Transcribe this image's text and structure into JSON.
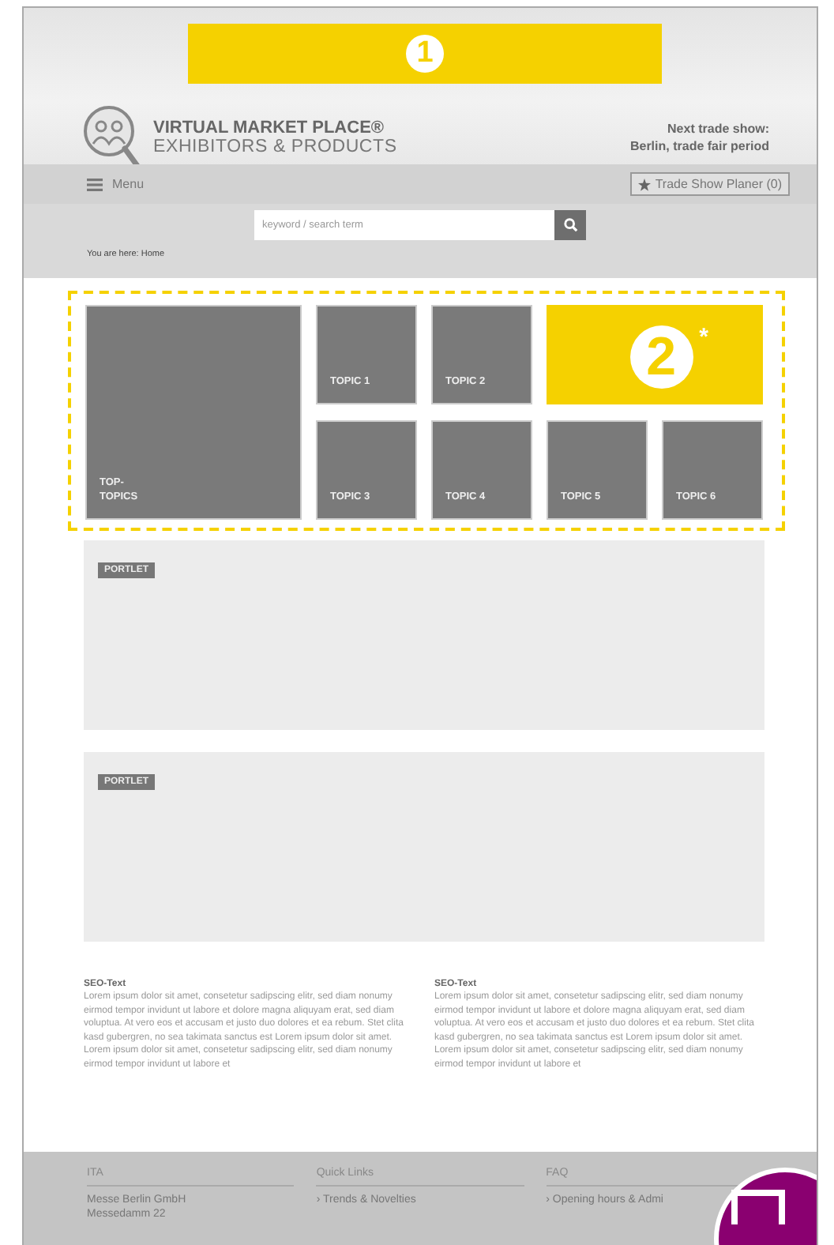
{
  "header_marker": "1",
  "logo": {
    "title": "VIRTUAL MARKET PLACE®",
    "subtitle": "EXHIBITORS & PRODUCTS"
  },
  "next_show": {
    "label": "Next trade show:",
    "value": "Berlin, trade fair period"
  },
  "nav": {
    "menu": "Menu",
    "planner": "Trade Show Planer (0)"
  },
  "search": {
    "placeholder": "keyword / search term"
  },
  "breadcrumb": "You are here: Home",
  "tiles": [
    {
      "kind": "top",
      "lines": [
        "TOP-",
        "TOPICS"
      ]
    },
    {
      "kind": "topic",
      "lines": [
        "TOPIC 1"
      ]
    },
    {
      "kind": "topic",
      "lines": [
        "TOPIC 2"
      ]
    },
    {
      "kind": "marker",
      "lines": [
        "2"
      ],
      "note": "*"
    },
    {
      "kind": "topic",
      "lines": [
        "TOPIC 3"
      ]
    },
    {
      "kind": "topic",
      "lines": [
        "TOPIC 4"
      ]
    },
    {
      "kind": "topic",
      "lines": [
        "TOPIC 5"
      ]
    },
    {
      "kind": "topic",
      "lines": [
        "TOPIC 6"
      ]
    }
  ],
  "portlets": [
    "PORTLET",
    "PORTLET"
  ],
  "seo": [
    {
      "title": "SEO-Text",
      "text": "Lorem ipsum dolor sit amet, consetetur sadipscing elitr, sed diam nonumy eirmod tempor invidunt ut labore et dolore magna aliquyam erat, sed diam voluptua. At vero eos et accusam et justo duo dolores et ea rebum. Stet clita kasd gubergren, no sea takimata sanctus est Lorem ipsum dolor sit amet. Lorem ipsum dolor sit amet, consetetur sadipscing elitr, sed diam nonumy eirmod tempor invidunt ut labore et"
    },
    {
      "title": "SEO-Text",
      "text": "Lorem ipsum dolor sit amet, consetetur sadipscing elitr, sed diam nonumy eirmod tempor invidunt ut labore et dolore magna aliquyam erat, sed diam voluptua. At vero eos et accusam et justo duo dolores et ea rebum. Stet clita kasd gubergren, no sea takimata sanctus est Lorem ipsum dolor sit amet. Lorem ipsum dolor sit amet, consetetur sadipscing elitr, sed diam nonumy eirmod tempor invidunt ut labore et"
    }
  ],
  "footer": [
    {
      "heading": "ITA",
      "items": [
        "Messe Berlin GmbH",
        "Messedamm 22"
      ]
    },
    {
      "heading": "Quick Links",
      "items": [
        "› Trends & Novelties"
      ]
    },
    {
      "heading": "FAQ",
      "items": [
        "› Opening hours & Admi"
      ]
    }
  ]
}
